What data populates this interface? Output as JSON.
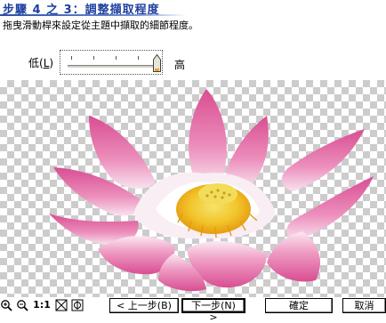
{
  "header": {
    "title": "步驟 4 之 3：調整擷取程度",
    "description": "拖曳滑動桿來設定從主題中擷取的細節程度。"
  },
  "slider": {
    "low_label": "低(L)",
    "low_prefix": "低(",
    "low_key": "L",
    "low_suffix": ")",
    "high_label": "高",
    "value": 1.0
  },
  "toolbar": {
    "zoom_in_icon": "magnifier-plus-icon",
    "zoom_out_icon": "magnifier-minus-icon",
    "actual_size_label": "1:1",
    "fit_icon": "fit-window-icon",
    "background_icon": "background-toggle-icon"
  },
  "buttons": {
    "back": "< 上一步(B)",
    "next": "下一步(N) >",
    "ok": "確定",
    "cancel": "取消"
  },
  "colors": {
    "title": "#1f3f9f",
    "petal_pink": "#e0579a",
    "petal_light": "#f7d3e6",
    "center_yellow": "#f2b818"
  }
}
